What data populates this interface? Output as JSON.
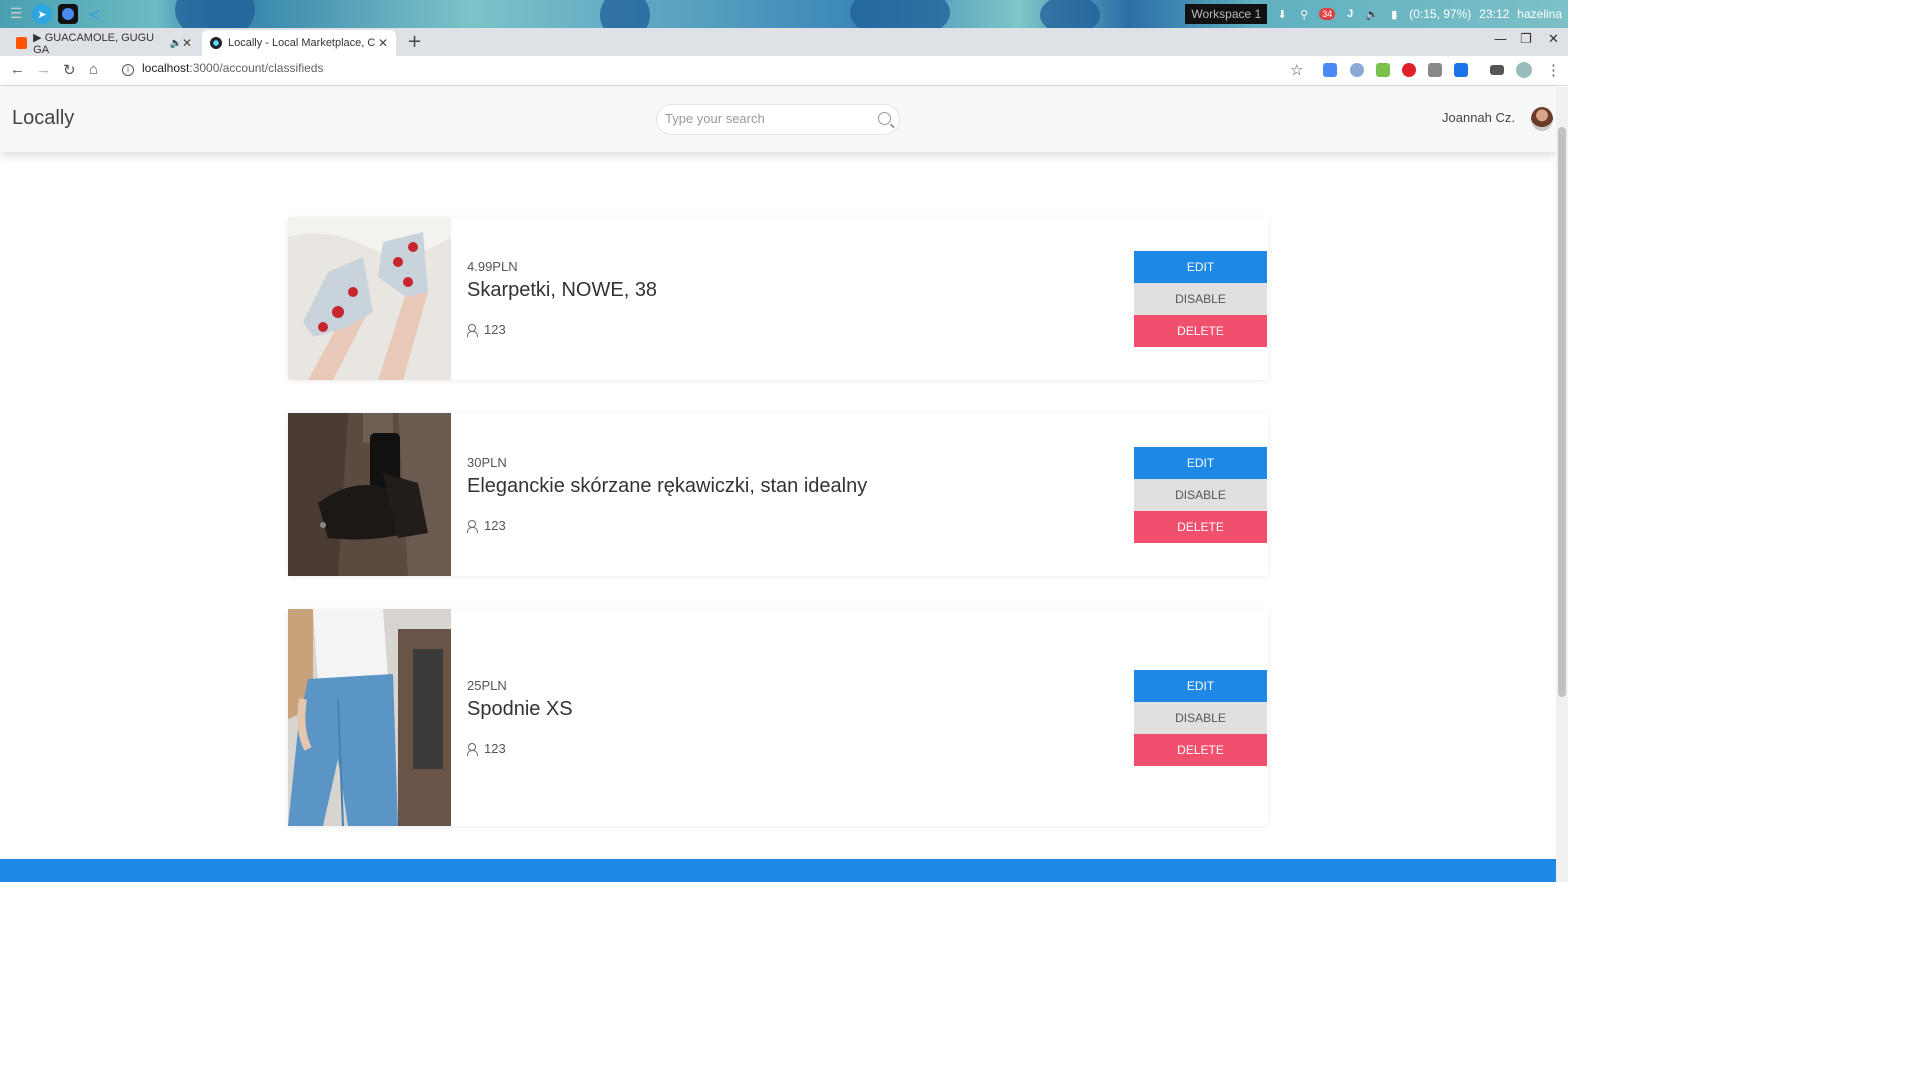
{
  "os": {
    "workspace": "Workspace 1",
    "notification_count": "34",
    "battery": "(0:15, 97%)",
    "time": "23:12",
    "user": "hazelina"
  },
  "browser": {
    "tabs": [
      {
        "label": "▶ GUACAMOLE, GUGU GA",
        "active": false
      },
      {
        "label": "Locally - Local Marketplace, C",
        "active": true
      }
    ],
    "url_host": "localhost",
    "url_path": ":3000/account/classifieds"
  },
  "app": {
    "logo": "Locally",
    "search_placeholder": "Type your search",
    "username": "Joannah Cz."
  },
  "listings": [
    {
      "price": "4.99PLN",
      "title": "Skarpetki, NOWE, 38",
      "views": "123"
    },
    {
      "price": "30PLN",
      "title": "Eleganckie skórzane rękawiczki, stan idealny",
      "views": "123"
    },
    {
      "price": "25PLN",
      "title": "Spodnie XS",
      "views": "123"
    }
  ],
  "actions": {
    "edit": "EDIT",
    "disable": "DISABLE",
    "delete": "DELETE"
  },
  "colors": {
    "primary": "#1e88e5",
    "danger": "#f0506e",
    "neutral": "#e0e0e0"
  }
}
